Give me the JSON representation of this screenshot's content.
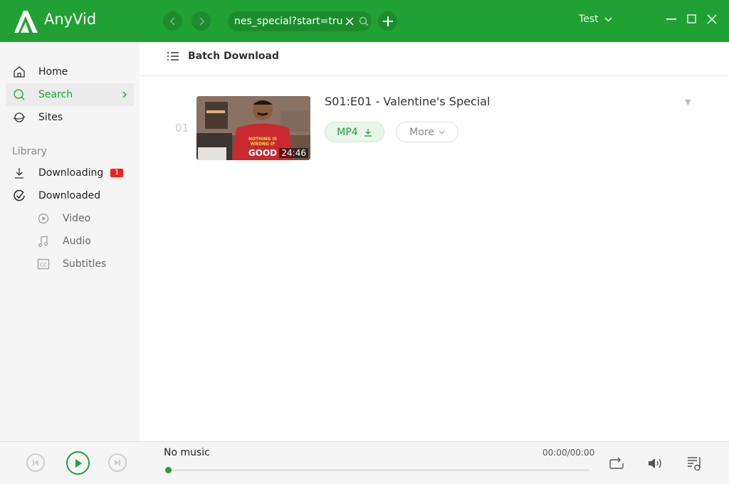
{
  "app": {
    "name": "AnyVid",
    "brand_color": "#21a034"
  },
  "titlebar": {
    "back_icon": "chevron-left",
    "forward_icon": "chevron-right",
    "url_value": "nes_special?start=true",
    "clear_icon": "x",
    "search_icon": "magnifier",
    "add_icon": "plus",
    "user_label": "Test",
    "window_controls": [
      "minimize",
      "maximize",
      "close"
    ]
  },
  "sidebar": {
    "items": [
      {
        "label": "Home",
        "icon": "home"
      },
      {
        "label": "Search",
        "icon": "search",
        "active": true
      },
      {
        "label": "Sites",
        "icon": "planet"
      }
    ],
    "library_heading": "Library",
    "library": [
      {
        "label": "Downloading",
        "icon": "download",
        "badge": "1"
      },
      {
        "label": "Downloaded",
        "icon": "check-circle"
      },
      {
        "label": "Video",
        "icon": "play-circle"
      },
      {
        "label": "Audio",
        "icon": "music-note"
      },
      {
        "label": "Subtitles",
        "icon": "cc"
      }
    ]
  },
  "main": {
    "toolbar": {
      "batch_label": "Batch Download"
    },
    "results": [
      {
        "index": "01",
        "title": "S01:E01 - Valentine's Special",
        "duration": "24:46",
        "thumbnail_text": "NOTHING IS WRONG IF IT FEELS GOOD",
        "format_label": "MP4",
        "more_label": "More"
      }
    ]
  },
  "player": {
    "track_title": "No music",
    "time": "00:00/00:00",
    "progress": 0
  }
}
